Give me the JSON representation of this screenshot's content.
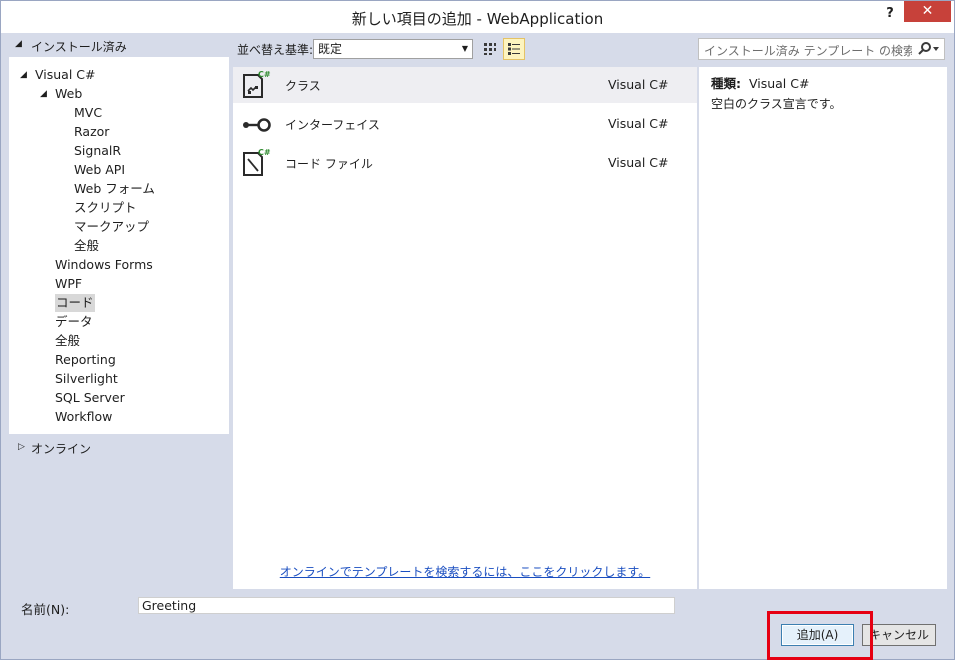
{
  "window": {
    "title": "新しい項目の追加 - WebApplication",
    "help_label": "?",
    "close_label": "✕"
  },
  "left_panel": {
    "header": "インストール済み",
    "tree": [
      {
        "label": "Visual C#",
        "level": 0,
        "expanded": true
      },
      {
        "label": "Web",
        "level": 1,
        "expanded": true
      },
      {
        "label": "MVC",
        "level": 2
      },
      {
        "label": "Razor",
        "level": 2
      },
      {
        "label": "SignalR",
        "level": 2
      },
      {
        "label": "Web API",
        "level": 2
      },
      {
        "label": "Web フォーム",
        "level": 2
      },
      {
        "label": "スクリプト",
        "level": 2
      },
      {
        "label": "マークアップ",
        "level": 2
      },
      {
        "label": "全般",
        "level": 2
      },
      {
        "label": "Windows Forms",
        "level": 1
      },
      {
        "label": "WPF",
        "level": 1
      },
      {
        "label": "コード",
        "level": 1,
        "selected": true
      },
      {
        "label": "データ",
        "level": 1
      },
      {
        "label": "全般",
        "level": 1
      },
      {
        "label": "Reporting",
        "level": 1
      },
      {
        "label": "Silverlight",
        "level": 1
      },
      {
        "label": "SQL Server",
        "level": 1
      },
      {
        "label": "Workflow",
        "level": 1
      }
    ],
    "online": "オンライン"
  },
  "toolbar": {
    "sort_label": "並べ替え基準:",
    "sort_value": "既定",
    "search_placeholder": "インストール済み テンプレート の検索 (Ctrl+E)"
  },
  "templates": [
    {
      "name": "クラス",
      "language": "Visual C#",
      "icon": "class-icon",
      "selected": true
    },
    {
      "name": "インターフェイス",
      "language": "Visual C#",
      "icon": "interface-icon"
    },
    {
      "name": "コード ファイル",
      "language": "Visual C#",
      "icon": "code-file-icon"
    }
  ],
  "online_link": "オンラインでテンプレートを検索するには、ここをクリックします。",
  "details": {
    "type_label": "種類:",
    "type_value": "Visual C#",
    "description": "空白のクラス宣言です。"
  },
  "bottom": {
    "name_label": "名前(N):",
    "name_value": "Greeting",
    "add_label": "追加(A)",
    "cancel_label": "キャンセル"
  },
  "colors": {
    "accent_close": "#c7413a",
    "highlight": "#e60012",
    "link": "#1a4ec0",
    "chrome": "#d6dbe9"
  }
}
